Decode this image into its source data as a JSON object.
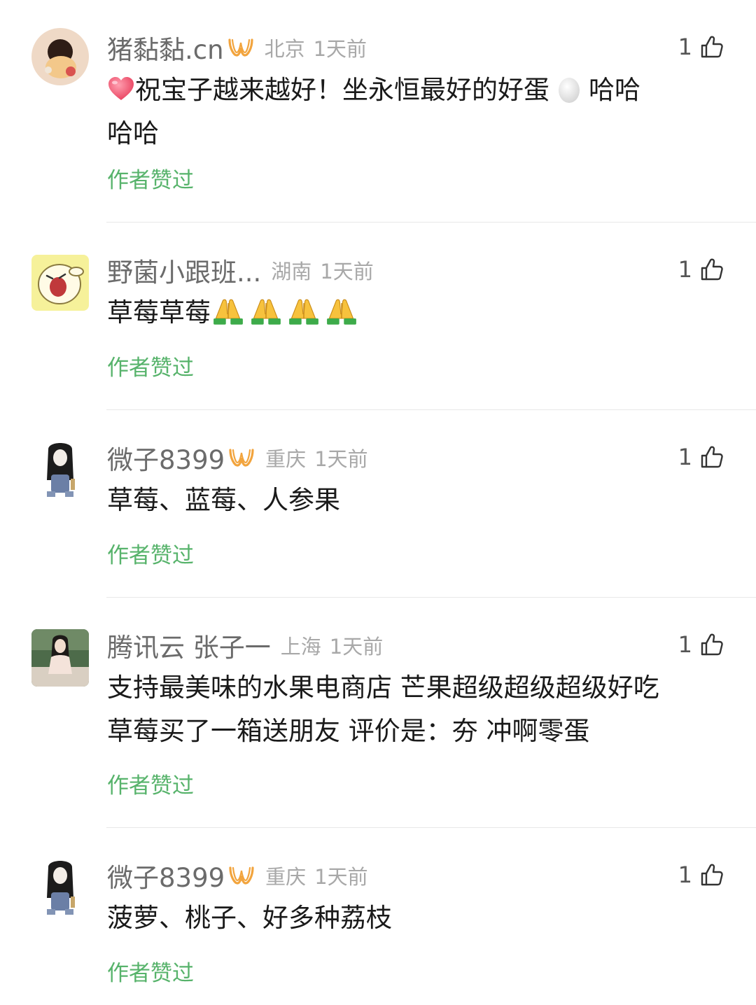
{
  "author_liked_label": "作者赞过",
  "colors": {
    "green": "#57b36b",
    "vip_gold": "#f2a43d",
    "name_gray": "#6b6b6b",
    "meta_gray": "#a8a8a8"
  },
  "comments": [
    {
      "username": "猪黏黏.cn",
      "vip": true,
      "location": "北京",
      "time": "1天前",
      "likes": "1",
      "lines": [
        {
          "prefix": "",
          "emoji": "heart",
          "text": "祝宝子越来越好！坐永恒最好的好蛋",
          "emoji2": "egg",
          "suffix": "哈哈"
        },
        {
          "text": "哈哈"
        }
      ],
      "author_liked": true
    },
    {
      "username": "野菌小跟班...",
      "vip": false,
      "location": "湖南",
      "time": "1天前",
      "likes": "1",
      "text": "草莓草莓",
      "emoji": "folded-hands x4",
      "author_liked": true
    },
    {
      "username": "微子8399",
      "vip": true,
      "location": "重庆",
      "time": "1天前",
      "likes": "1",
      "text": "草莓、蓝莓、人参果",
      "author_liked": true
    },
    {
      "username": "腾讯云 张子一",
      "vip": false,
      "location": "上海",
      "time": "1天前",
      "likes": "1",
      "line1": "支持最美味的水果电商店 芒果超级超级超级好吃",
      "line2": "草莓买了一箱送朋友 评价是：夯 冲啊零蛋",
      "author_liked": true
    },
    {
      "username": "微子8399",
      "vip": true,
      "location": "重庆",
      "time": "1天前",
      "likes": "1",
      "text": "菠萝、桃子、好多种荔枝",
      "author_liked": true
    }
  ]
}
